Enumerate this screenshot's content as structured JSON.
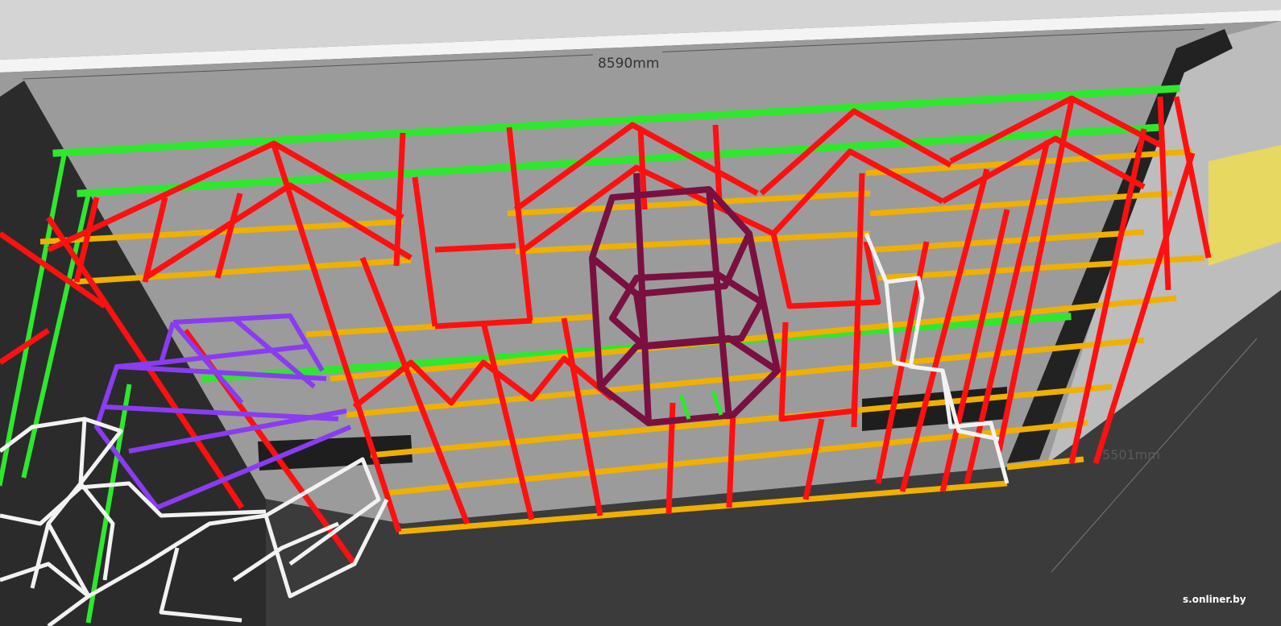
{
  "dimensions": {
    "width_label": "8590mm",
    "depth_label": "5501mm"
  },
  "watermark": "s.onliner.by",
  "colors": {
    "top_rails": "#2ee82e",
    "main_frame": "#ff1010",
    "cross_beams": "#f0b000",
    "central_tower": "#7a1040",
    "stair_frame": "#8a3cf0",
    "lattice": "#f2f2f2",
    "ceiling": "#c8c8c8",
    "wall": "#9a9a9a",
    "floor": "#3a3a3a"
  }
}
